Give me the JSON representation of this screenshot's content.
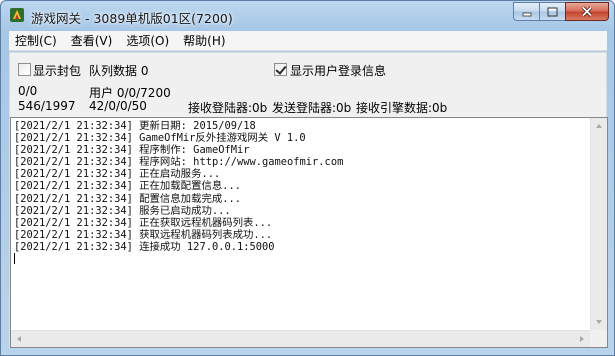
{
  "window": {
    "title": "游戏网关 - 3089单机版01区(7200)",
    "icon": "app-game-icon"
  },
  "menu": {
    "items": [
      {
        "label": "控制(C)"
      },
      {
        "label": "查看(V)"
      },
      {
        "label": "选项(O)"
      },
      {
        "label": "帮助(H)"
      }
    ]
  },
  "options": {
    "show_envelope_label": "显示封包",
    "show_envelope_checked": false,
    "queue_label": "队列数据 0",
    "show_login_label": "显示用户登录信息",
    "show_login_checked": true
  },
  "stats": {
    "row1_col1": "0/0",
    "row1_col2": "用户 0/0/7200",
    "row2_col1": "546/1997",
    "row2_col2": "42/0/0/50",
    "recv_login": "接收登陆器:0b",
    "send_login": "发送登陆器:0b",
    "recv_engine": "接收引擎数据:0b"
  },
  "log": {
    "lines": [
      "[2021/2/1 21:32:34] 更新日期: 2015/09/18",
      "[2021/2/1 21:32:34] GameOfMir反外挂游戏网关 V 1.0",
      "[2021/2/1 21:32:34] 程序制作: GameOfMir",
      "[2021/2/1 21:32:34] 程序网站: http://www.gameofmir.com",
      "[2021/2/1 21:32:34] 正在启动服务...",
      "[2021/2/1 21:32:34] 正在加载配置信息...",
      "[2021/2/1 21:32:34] 配置信息加载完成...",
      "[2021/2/1 21:32:34] 服务已启动成功...",
      "[2021/2/1 21:32:34] 正在获取远程机器码列表...",
      "[2021/2/1 21:32:34] 获取远程机器码列表成功...",
      "[2021/2/1 21:32:34] 连接成功 127.0.0.1:5000"
    ]
  },
  "colors": {
    "title_bar": "#a6c7e6",
    "close_button": "#c4452f",
    "client_bg": "#f0f0f0"
  }
}
